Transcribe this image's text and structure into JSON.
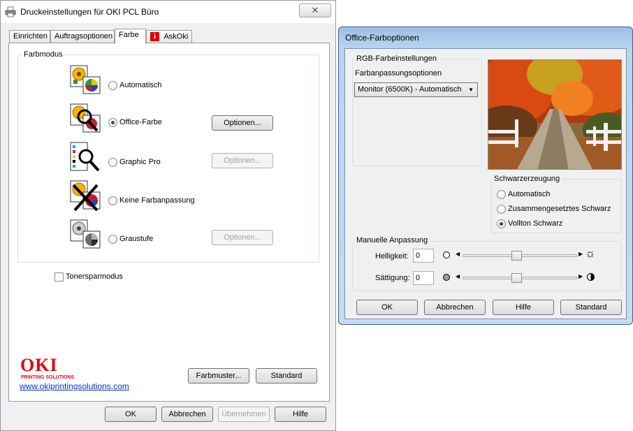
{
  "main_window": {
    "title": "Druckeinstellungen für OKI PCL Büro",
    "close_glyph": "✕",
    "tabs": [
      {
        "label": "Einrichten"
      },
      {
        "label": "Auftragsoptionen"
      },
      {
        "label": "Farbe"
      },
      {
        "label": "AskOki"
      }
    ],
    "askoki_badge": "i",
    "colormode_group_label": "Farbmodus",
    "modes": [
      {
        "label": "Automatisch",
        "selected": false,
        "options_label": null
      },
      {
        "label": "Office-Farbe",
        "selected": true,
        "options_label": "Optionen..."
      },
      {
        "label": "Graphic Pro",
        "selected": false,
        "options_label": "Optionen..."
      },
      {
        "label": "Keine Farbanpassung",
        "selected": false,
        "options_label": null
      },
      {
        "label": "Graustufe",
        "selected": false,
        "options_label": "Optionen..."
      }
    ],
    "toner_save_label": "Tonersparmodus",
    "brand_logo": "OKI",
    "brand_tagline": "PRINTING SOLUTIONS",
    "brand_link": "www.okiprintingsolutions.com",
    "sample_button": "Farbmuster...",
    "standard_button": "Standard",
    "footer": {
      "ok": "OK",
      "cancel": "Abbrechen",
      "apply": "Übernehmen",
      "help": "Hilfe"
    }
  },
  "dialog": {
    "title": "Office-Farboptionen",
    "rgb_group_label": "RGB-Farbeinstellungen",
    "match_options_label": "Farbanpassungsoptionen",
    "match_value": "Monitor (6500K) - Automatisch",
    "black_group_label": "Schwarzerzeugung",
    "black_options": [
      {
        "label": "Automatisch",
        "selected": false
      },
      {
        "label": "Zusammengesetztes Schwarz",
        "selected": false
      },
      {
        "label": "Vollton Schwarz",
        "selected": true
      }
    ],
    "manual_group_label": "Manuelle Anpassung",
    "brightness_label": "Helligkeit:",
    "brightness_value": "0",
    "saturation_label": "Sättigung:",
    "saturation_value": "0",
    "footer": {
      "ok": "OK",
      "cancel": "Abbrechen",
      "help": "Hilfe",
      "standard": "Standard"
    }
  }
}
